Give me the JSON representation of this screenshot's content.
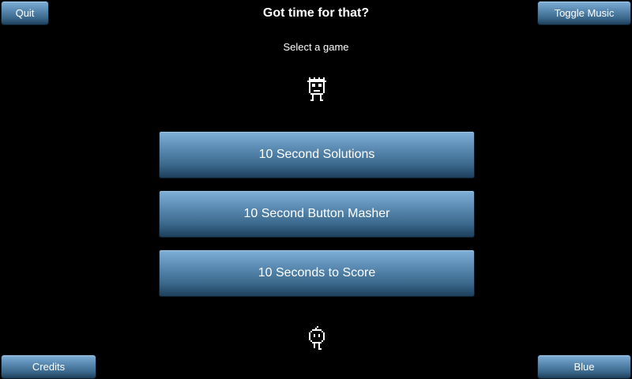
{
  "header": {
    "title": "Got time for that?",
    "subtitle": "Select a game"
  },
  "buttons": {
    "quit": "Quit",
    "toggle_music": "Toggle Music",
    "credits": "Credits",
    "theme": "Blue"
  },
  "games": [
    {
      "label": "10 Second Solutions"
    },
    {
      "label": "10 Second Button Masher"
    },
    {
      "label": "10 Seconds to Score"
    }
  ],
  "sprites": {
    "top": "spiky-hair-character-icon",
    "bottom": "round-head-character-icon"
  },
  "colors": {
    "background": "#000000",
    "button_top": "#7fb0d8",
    "button_bottom": "#1d3f5b",
    "text": "#ffffff"
  }
}
